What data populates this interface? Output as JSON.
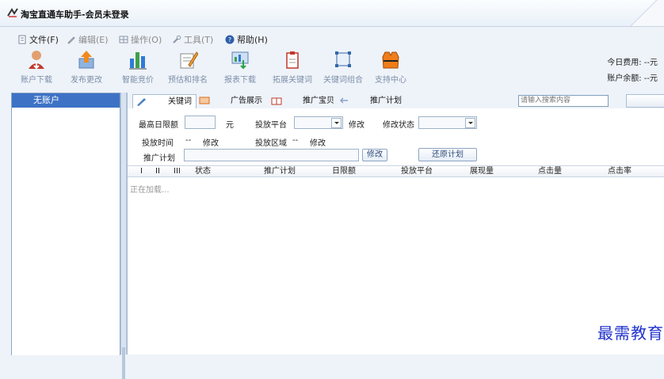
{
  "window": {
    "title": "淘宝直通车助手-会员未登录"
  },
  "menu": [
    {
      "label": "文件(F)",
      "icon": "file-icon",
      "enabled": true
    },
    {
      "label": "编辑(E)",
      "icon": "pencil-icon",
      "enabled": false
    },
    {
      "label": "操作(O)",
      "icon": "grid-icon",
      "enabled": false
    },
    {
      "label": "工具(T)",
      "icon": "wrench-icon",
      "enabled": false
    },
    {
      "label": "帮助(H)",
      "icon": "help-icon",
      "enabled": true
    }
  ],
  "toolbar": [
    {
      "label": "账户下载",
      "icon": "user-download-icon"
    },
    {
      "label": "发布更改",
      "icon": "publish-arrow-icon"
    },
    {
      "label": "智能竞价",
      "icon": "bar-chart-icon"
    },
    {
      "label": "预估和排名",
      "icon": "notepad-pencil-icon"
    },
    {
      "label": "报表下载",
      "icon": "report-download-icon"
    },
    {
      "label": "拓展关键词",
      "icon": "clipboard-icon"
    },
    {
      "label": "关键词组合",
      "icon": "keyword-combine-icon"
    },
    {
      "label": "支持中心",
      "icon": "life-vest-icon"
    }
  ],
  "account": {
    "today_cost_label": "今日费用:",
    "today_cost_value": "--元",
    "balance_label": "账户余额:",
    "balance_value": "--元"
  },
  "sidebar": {
    "active_item": "无账户"
  },
  "tabs": [
    {
      "label": "关键词",
      "icon": "pen-tab-icon",
      "active": true
    },
    {
      "label": "广告展示",
      "icon": "ad-tab-icon",
      "active": false
    },
    {
      "label": "推广宝贝",
      "icon": "gift-tab-icon",
      "active": false
    },
    {
      "label": "推广计划",
      "icon": "arrow-tab-icon",
      "active": false
    }
  ],
  "search": {
    "placeholder": "请输入搜索内容"
  },
  "form": {
    "max_daily_label": "最高日限额",
    "max_daily_value": "",
    "yuan": "元",
    "platform_label": "投放平台",
    "platform_modify": "修改",
    "status_label": "修改状态",
    "time_label": "投放时间",
    "time_value": "--",
    "time_modify": "修改",
    "region_label": "投放区域",
    "region_value": "--",
    "region_modify": "修改",
    "plan_label": "推广计划",
    "plan_modify_btn": "修改",
    "restore_btn": "还原计划"
  },
  "grid": {
    "columns": [
      "I",
      "II",
      "III",
      "状态",
      "推广计划",
      "日限额",
      "投放平台",
      "展现量",
      "点击量",
      "点击率"
    ],
    "loading_text": "正在加载..."
  },
  "watermark": "最需教育"
}
